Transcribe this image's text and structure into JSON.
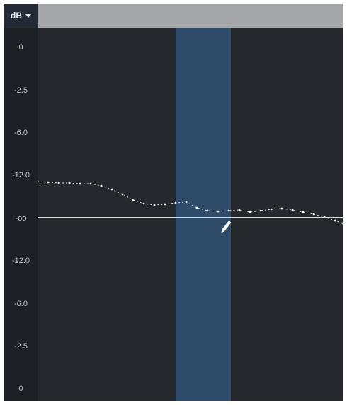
{
  "ruler": {
    "unit": "dB",
    "labels": [
      "0",
      "-2.5",
      "-6.0",
      "-12.0",
      "-oo",
      "-12.0",
      "-6.0",
      "-2.5",
      "0"
    ]
  },
  "envelope": {
    "points": [
      [
        0,
        252
      ],
      [
        15,
        253
      ],
      [
        30,
        254
      ],
      [
        45,
        254
      ],
      [
        60,
        255
      ],
      [
        75,
        255
      ],
      [
        90,
        258
      ],
      [
        105,
        263
      ],
      [
        120,
        270
      ],
      [
        135,
        278
      ],
      [
        150,
        283
      ],
      [
        165,
        285
      ],
      [
        180,
        284
      ],
      [
        195,
        282
      ],
      [
        210,
        281
      ],
      [
        225,
        289
      ],
      [
        240,
        293
      ],
      [
        255,
        294
      ],
      [
        270,
        293
      ],
      [
        285,
        292
      ],
      [
        300,
        295
      ],
      [
        315,
        293
      ],
      [
        330,
        291
      ],
      [
        345,
        290
      ],
      [
        360,
        292
      ],
      [
        375,
        295
      ],
      [
        390,
        298
      ],
      [
        405,
        302
      ],
      [
        420,
        307
      ],
      [
        431,
        311
      ]
    ]
  }
}
